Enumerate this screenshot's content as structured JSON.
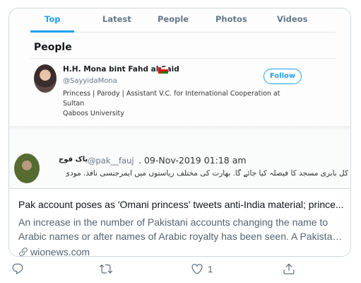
{
  "embedded_screenshot": {
    "tabs": [
      "Top",
      "Latest",
      "People",
      "Photos",
      "Videos"
    ],
    "active_tab": "Top",
    "section_title": "People",
    "profile": {
      "name": "H.H. Mona bint Fahd al Said",
      "handle": "@SayyidaMona",
      "bio_line1": "Princess | Parody | Assistant V.C. for International Cooperation at Sultan",
      "bio_line2": "Qaboos University",
      "follow_label": "Follow"
    },
    "tweet": {
      "display_name": "پاک فوج",
      "handle": "@pak__fauj",
      "date": ". 09-Nov-2019 01:18 am",
      "text": "کل بابری مسجد کا فیصلہ کیا جائے گا. بھارت کی مختلف ریاستوں میں ایمرجنسی نافذ. مودی"
    }
  },
  "link_card": {
    "title": "Pak account poses as 'Omani princess' tweets anti-India material; prince...",
    "description_line1": "An increase in the number of Pakistani accounts changing the name to",
    "description_line2": "Arabic names or after names of Arabic royalty has been seen. A Pakistan...",
    "domain": "wionews.com"
  },
  "actions": {
    "reply_count": "",
    "retweet_count": "",
    "like_count": "1",
    "share_count": ""
  },
  "colors": {
    "accent": "#1da1f2",
    "border": "#cfd9de",
    "secondary_text": "#536471"
  }
}
